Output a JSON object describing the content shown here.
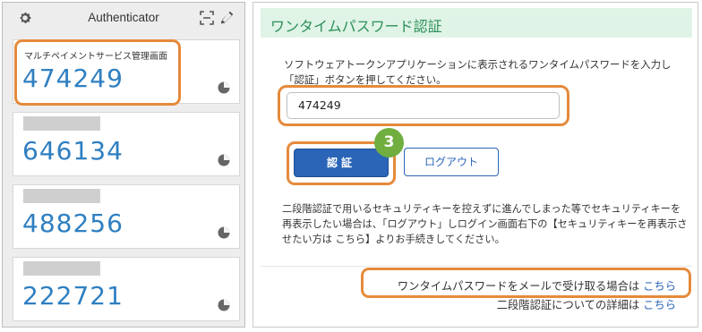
{
  "authenticator": {
    "title": "Authenticator",
    "accounts": [
      {
        "name": "マルチペイメントサービス管理画面",
        "code": "474249"
      },
      {
        "name": "",
        "code": "646134"
      },
      {
        "name": "",
        "code": "488256"
      },
      {
        "name": "",
        "code": "222721"
      }
    ]
  },
  "otp": {
    "title": "ワンタイムパスワード認証",
    "instruction": "ソフトウェアトークンアプリケーションに表示されるワンタイムパスワードを入力し「認証」ボタンを押してください。",
    "input_value": "474249",
    "submit_label": "認証",
    "logout_label": "ログアウト",
    "step_number": "3",
    "note": "二段階認証で用いるセキュリティキーを控えずに進んでしまった等でセキュリティキーを再表示したい場合は、「ログアウト」しログイン画面右下の【セキュリティキーを再表示させたい方は こちら】よりお手続きしてください。",
    "mail_text": "ワンタイムパスワードをメールで受け取る場合は",
    "mail_link": "こちら",
    "detail_text": "二段階認証についての詳細は",
    "detail_link": "こちら"
  },
  "colors": {
    "highlight": "#e58a3b",
    "code_blue": "#2f7fc1",
    "primary_button": "#2a65b8",
    "header_bg": "#dff4e6",
    "header_text": "#2d8f5a",
    "badge_green": "#6fae3f"
  }
}
